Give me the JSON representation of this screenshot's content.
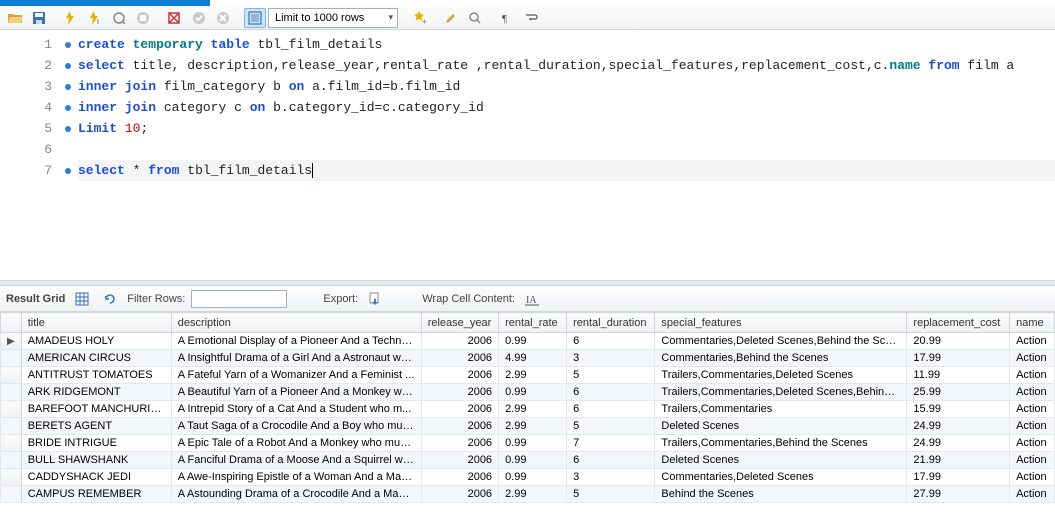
{
  "toolbar": {
    "limit_label": "Limit to 1000 rows"
  },
  "editor": {
    "lines": [
      {
        "n": 1,
        "dot": true
      },
      {
        "n": 2,
        "dot": true
      },
      {
        "n": 3,
        "dot": true
      },
      {
        "n": 4,
        "dot": true
      },
      {
        "n": 5,
        "dot": true
      },
      {
        "n": 6,
        "dot": false
      },
      {
        "n": 7,
        "dot": true
      }
    ],
    "sql": {
      "l1": {
        "a": "create",
        "b": "temporary",
        "c": "table",
        "d": "tbl_film_details"
      },
      "l2": {
        "a": "select",
        "b": "title, description,release_year,rental_rate ,rental_duration,special_features,replacement_cost,c.",
        "c": "name",
        "d": "from",
        "e": "film a"
      },
      "l3": {
        "a": "inner",
        "b": "join",
        "c": "film_category b",
        "d": "on",
        "e": "a.film_id=b.film_id"
      },
      "l4": {
        "a": "inner",
        "b": "join",
        "c": "category c",
        "d": "on",
        "e": "b.category_id=c.category_id"
      },
      "l5": {
        "a": "Limit",
        "b": "10",
        ";": ";"
      },
      "l7": {
        "a": "select",
        "b": "*",
        "c": "from",
        "d": "tbl_film_details"
      }
    }
  },
  "resultsbar": {
    "grid_label": "Result Grid",
    "filter_label": "Filter Rows:",
    "export_label": "Export:",
    "wrap_label": "Wrap Cell Content:"
  },
  "grid": {
    "columns": [
      "title",
      "description",
      "release_year",
      "rental_rate",
      "rental_duration",
      "special_features",
      "replacement_cost",
      "name"
    ],
    "rows": [
      {
        "title": "AMADEUS HOLY",
        "description": "A Emotional Display of a Pioneer And a Technica...",
        "release_year": "2006",
        "rental_rate": "0.99",
        "rental_duration": "6",
        "special_features": "Commentaries,Deleted Scenes,Behind the Scenes",
        "replacement_cost": "20.99",
        "name": "Action"
      },
      {
        "title": "AMERICAN CIRCUS",
        "description": "A Insightful Drama of a Girl And a Astronaut wh...",
        "release_year": "2006",
        "rental_rate": "4.99",
        "rental_duration": "3",
        "special_features": "Commentaries,Behind the Scenes",
        "replacement_cost": "17.99",
        "name": "Action"
      },
      {
        "title": "ANTITRUST TOMATOES",
        "description": "A Fateful Yarn of a Womanizer And a Feminist ...",
        "release_year": "2006",
        "rental_rate": "2.99",
        "rental_duration": "5",
        "special_features": "Trailers,Commentaries,Deleted Scenes",
        "replacement_cost": "11.99",
        "name": "Action"
      },
      {
        "title": "ARK RIDGEMONT",
        "description": "A Beautiful Yarn of a Pioneer And a Monkey wh...",
        "release_year": "2006",
        "rental_rate": "0.99",
        "rental_duration": "6",
        "special_features": "Trailers,Commentaries,Deleted Scenes,Behind t...",
        "replacement_cost": "25.99",
        "name": "Action"
      },
      {
        "title": "BAREFOOT MANCHURIAN",
        "description": "A Intrepid Story of a Cat And a Student who m...",
        "release_year": "2006",
        "rental_rate": "2.99",
        "rental_duration": "6",
        "special_features": "Trailers,Commentaries",
        "replacement_cost": "15.99",
        "name": "Action"
      },
      {
        "title": "BERETS AGENT",
        "description": "A Taut Saga of a Crocodile And a Boy who must...",
        "release_year": "2006",
        "rental_rate": "2.99",
        "rental_duration": "5",
        "special_features": "Deleted Scenes",
        "replacement_cost": "24.99",
        "name": "Action"
      },
      {
        "title": "BRIDE INTRIGUE",
        "description": "A Epic Tale of a Robot And a Monkey who must ...",
        "release_year": "2006",
        "rental_rate": "0.99",
        "rental_duration": "7",
        "special_features": "Trailers,Commentaries,Behind the Scenes",
        "replacement_cost": "24.99",
        "name": "Action"
      },
      {
        "title": "BULL SHAWSHANK",
        "description": "A Fanciful Drama of a Moose And a Squirrel who...",
        "release_year": "2006",
        "rental_rate": "0.99",
        "rental_duration": "6",
        "special_features": "Deleted Scenes",
        "replacement_cost": "21.99",
        "name": "Action"
      },
      {
        "title": "CADDYSHACK JEDI",
        "description": "A Awe-Inspiring Epistle of a Woman And a Mad...",
        "release_year": "2006",
        "rental_rate": "0.99",
        "rental_duration": "3",
        "special_features": "Commentaries,Deleted Scenes",
        "replacement_cost": "17.99",
        "name": "Action"
      },
      {
        "title": "CAMPUS REMEMBER",
        "description": "A Astounding Drama of a Crocodile And a Mad ...",
        "release_year": "2006",
        "rental_rate": "2.99",
        "rental_duration": "5",
        "special_features": "Behind the Scenes",
        "replacement_cost": "27.99",
        "name": "Action"
      }
    ]
  }
}
